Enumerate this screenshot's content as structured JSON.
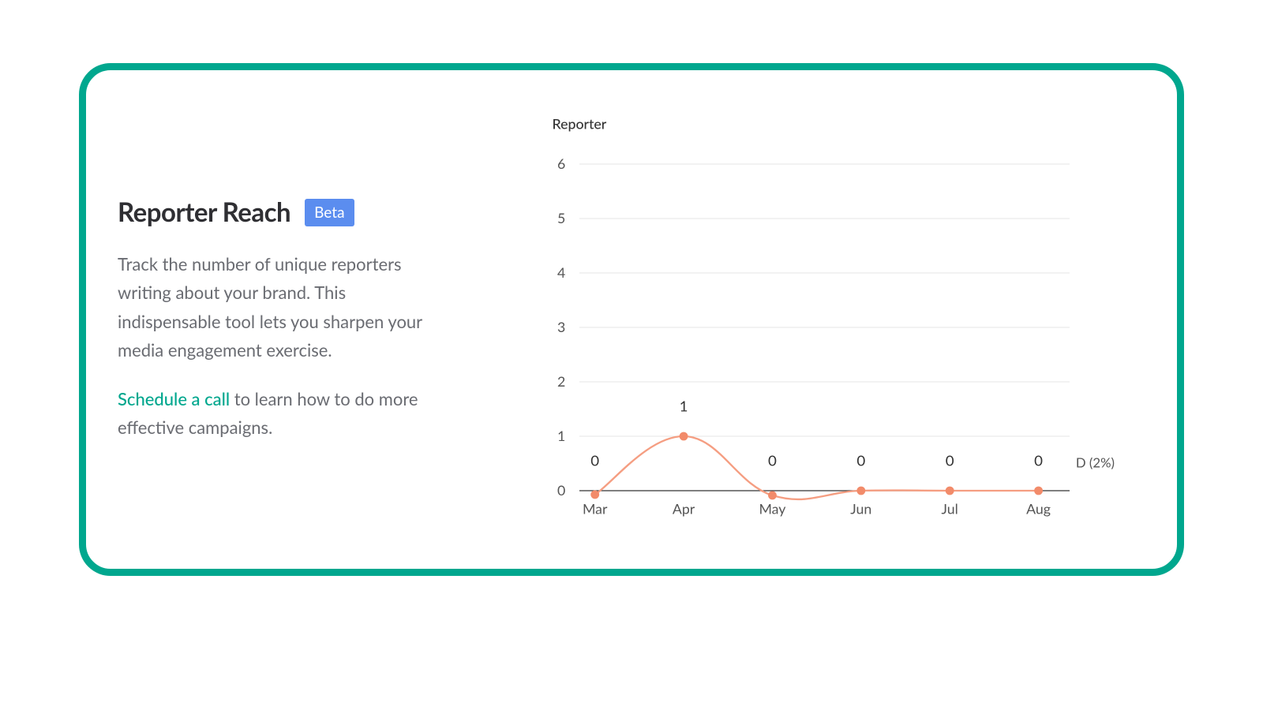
{
  "left_panel": {
    "title": "Reporter Reach",
    "badge": "Beta",
    "description": "Track the number of unique reporters writing about your brand. This indispensable tool lets you sharpen your media engagement exercise.",
    "cta_link_text": "Schedule a call",
    "cta_rest": " to learn how to do more effective campaigns."
  },
  "chart_data": {
    "type": "line",
    "title": "Reporter",
    "categories": [
      "Mar",
      "Apr",
      "May",
      "Jun",
      "Jul",
      "Aug"
    ],
    "values": [
      0,
      1,
      0,
      0,
      0,
      0
    ],
    "y_ticks": [
      0,
      1,
      2,
      3,
      4,
      5,
      6
    ],
    "ylim": [
      0,
      6
    ],
    "series_color": "#f28b6a",
    "right_annotation": "D (2%)"
  }
}
